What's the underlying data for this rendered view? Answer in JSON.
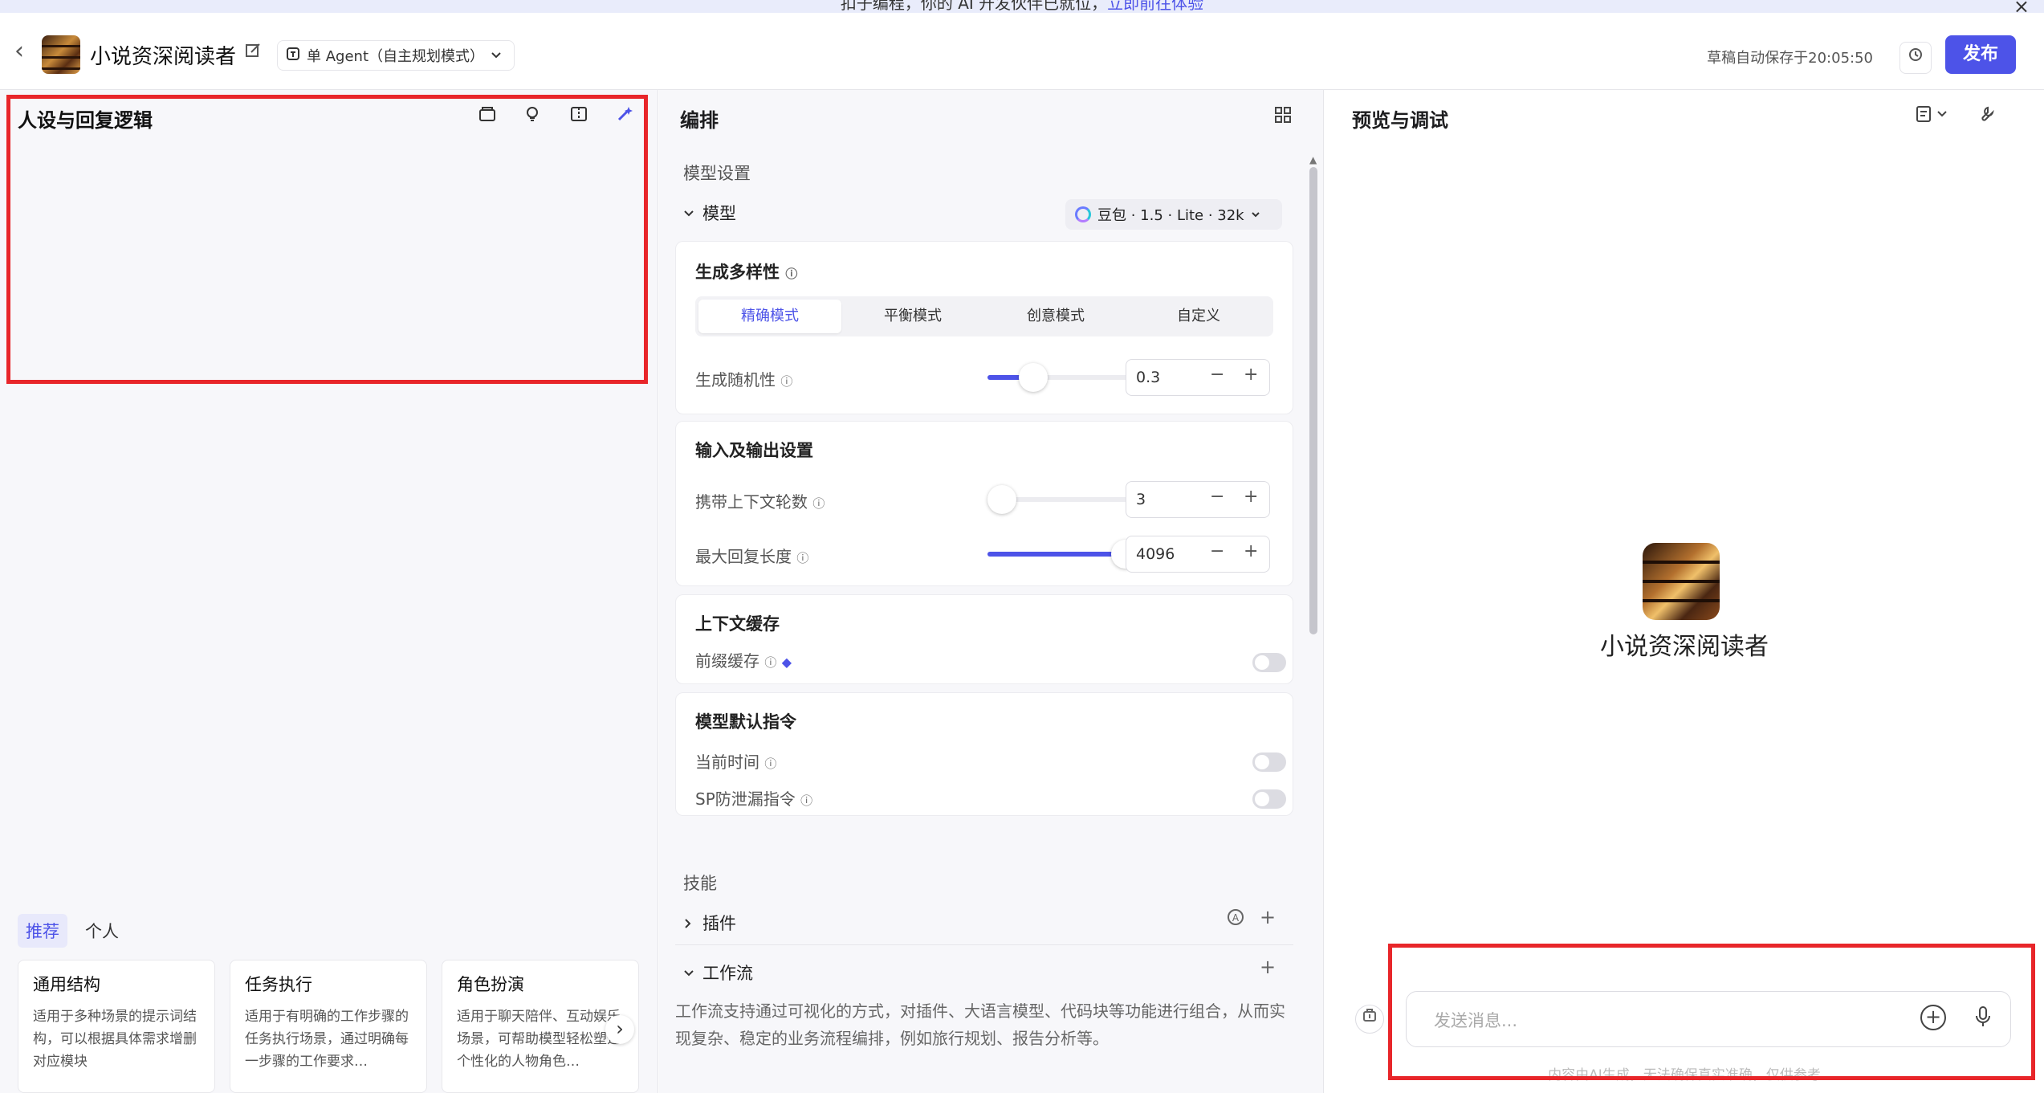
{
  "banner": {
    "text": "扣子编程，你的 AI 开发伙伴已就位，",
    "link": "立即前往体验",
    "close_icon": "×"
  },
  "header": {
    "back_icon": "‹",
    "app_name": "小说资深阅读者",
    "mode": "单 Agent（自主规划模式）",
    "autosave": "草稿自动保存于20:05:50",
    "publish": "发布"
  },
  "left": {
    "title": "人设与回复逻辑",
    "tabs": [
      "推荐",
      "个人"
    ],
    "cards": [
      {
        "title": "通用结构",
        "desc": "适用于多种场景的提示词结构，可以根据具体需求增删对应模块"
      },
      {
        "title": "任务执行",
        "desc": "适用于有明确的工作步骤的任务执行场景，通过明确每一步骤的工作要求…"
      },
      {
        "title": "角色扮演",
        "desc": "适用于聊天陪伴、互动娱乐场景，可帮助模型轻松塑造个性化的人物角色…"
      }
    ]
  },
  "middle": {
    "title": "编排",
    "model_settings": "模型设置",
    "model_label": "模型",
    "model_value": "豆包 · 1.5 · Lite · 32k",
    "diversity": {
      "title": "生成多样性",
      "modes": [
        "精确模式",
        "平衡模式",
        "创意模式",
        "自定义"
      ],
      "selected": "精确模式",
      "temperature_label": "生成随机性",
      "temperature_value": "0.3",
      "temperature_fraction": 0.3
    },
    "io": {
      "title": "输入及输出设置",
      "context_label": "携带上下文轮数",
      "context_value": "3",
      "context_fraction": 0.0,
      "max_label": "最大回复长度",
      "max_value": "4096",
      "max_fraction": 1.0
    },
    "cache": {
      "title": "上下文缓存",
      "prefix_label": "前缀缓存",
      "prefix_on": false
    },
    "defaults": {
      "title": "模型默认指令",
      "time_label": "当前时间",
      "time_on": false,
      "sp_label": "SP防泄漏指令",
      "sp_on": false
    },
    "skills": {
      "title": "技能",
      "plugin": "插件",
      "workflow": "工作流",
      "workflow_desc": "工作流支持通过可视化的方式，对插件、大语言模型、代码块等功能进行组合，从而实现复杂、稳定的业务流程编排，例如旅行规划、报告分析等。"
    },
    "minus": "−",
    "plus": "+"
  },
  "right": {
    "title": "预览与调试",
    "bot_name": "小说资深阅读者",
    "placeholder": "发送消息...",
    "disclaimer": "内容由AI生成，无法确保真实准确，仅供参考"
  },
  "colors": {
    "accent": "#4d53e8",
    "highlight_border": "#e8262a"
  }
}
